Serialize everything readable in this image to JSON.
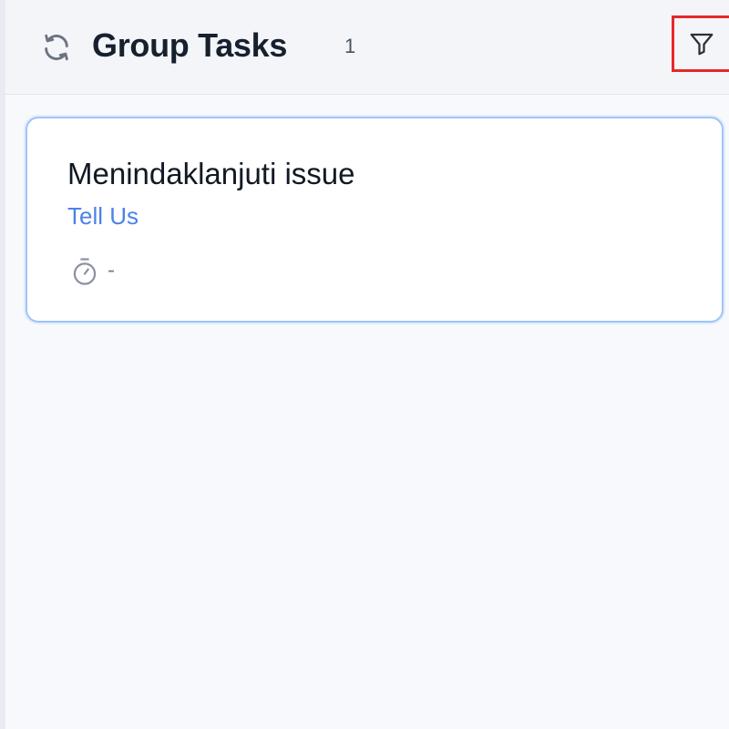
{
  "header": {
    "refresh_icon": "refresh-icon",
    "title": "Group Tasks",
    "count": "1",
    "filter_icon": "filter-icon"
  },
  "tasks": [
    {
      "name": "Menindaklanjuti issue",
      "group": "Tell Us",
      "timer_icon": "stopwatch-icon",
      "timer_value": "-"
    }
  ],
  "colors": {
    "title": "#17202e",
    "link": "#4d82e8",
    "card_border": "#9fc3f7",
    "highlight": "#e8272a"
  }
}
